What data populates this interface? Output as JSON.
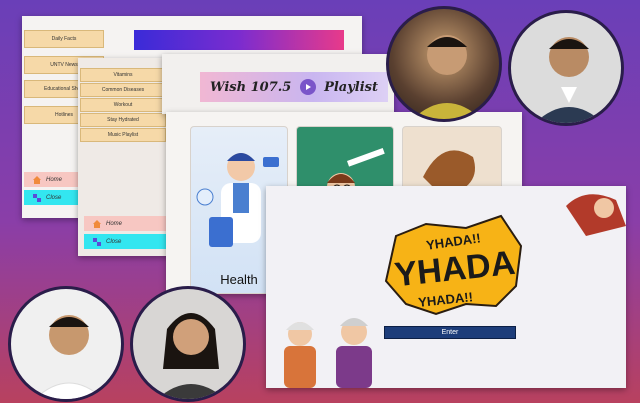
{
  "window_facts": {
    "menu": [
      "Daily Facts",
      "UNTV News",
      "Educational Show",
      "Hotlines"
    ],
    "home_label": "Home",
    "close_label": "Close"
  },
  "window_health": {
    "menu": [
      "Vitamins",
      "Common Diseases",
      "Workout",
      "Stay Hydrated",
      "Music Playlist"
    ],
    "home_label": "Home",
    "close_label": "Close"
  },
  "playlist": {
    "title_left": "Wish 107.5",
    "title_right": "Playlist"
  },
  "cards": {
    "health_label": "Health"
  },
  "yhada": {
    "logo_small_top": "YHADA!!",
    "logo_main": "YHADA",
    "logo_small_bottom": "YHADA!!",
    "enter_label": "Enter"
  },
  "colors": {
    "accent_purple": "#7b2ccf",
    "menu_button": "#f6d9a8",
    "home_button": "#f7c7c2",
    "close_button": "#33e6f0",
    "enter_button": "#1d3d7a",
    "logo_yellow": "#f7b316"
  }
}
